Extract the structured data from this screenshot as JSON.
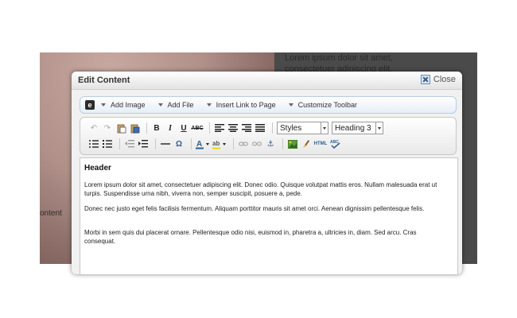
{
  "background": {
    "text_lines": [
      "Lorem ipsum dolor sit amet,",
      "consectetuer adipiscing elit."
    ],
    "content_label": "ontent"
  },
  "modal": {
    "title": "Edit Content",
    "close_label": "Close"
  },
  "top_toolbar": {
    "items": [
      {
        "label": "Add Image"
      },
      {
        "label": "Add File"
      },
      {
        "label": "Insert Link to Page"
      },
      {
        "label": "Customize Toolbar"
      }
    ]
  },
  "editor_toolbar": {
    "styles_value": "Styles",
    "heading_value": "Heading 3"
  },
  "document": {
    "header": "Header",
    "paragraphs": [
      "Lorem ipsum dolor sit amet, consectetuer adipiscing elit. Donec odio. Quisque volutpat mattis eros. Nullam malesuada erat ut turpis. Suspendisse urna nibh, viverra non, semper suscipit, posuere a, pede.",
      "Donec nec justo eget felis facilisis fermentum. Aliquam porttitor mauris sit amet orci. Aenean dignissim pellentesque felis.",
      "Morbi in sem quis dui placerat ornare. Pellentesque odio nisi, euismod in, pharetra a, ultricies in, diam. Sed arcu. Cras consequat."
    ]
  }
}
